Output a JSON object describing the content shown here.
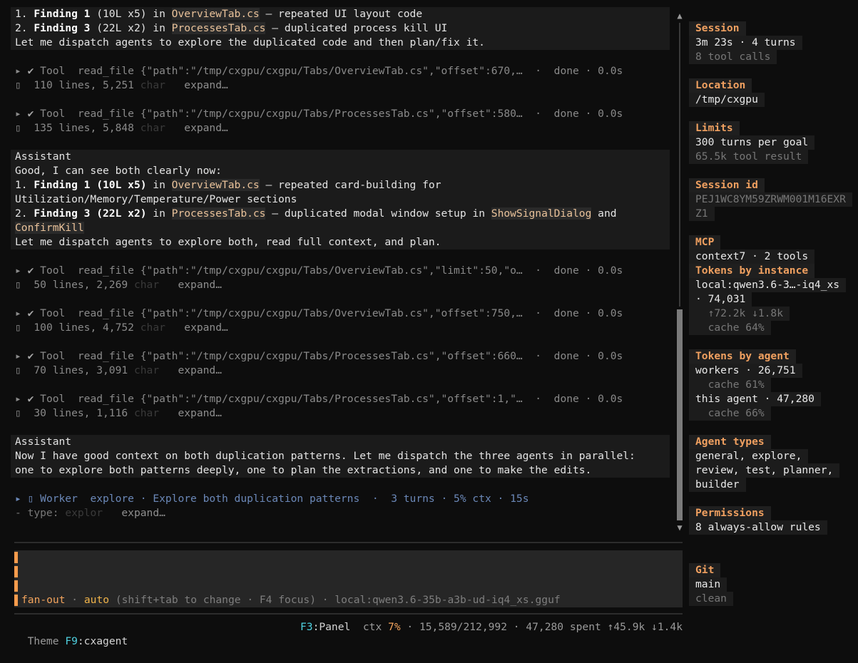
{
  "conversation": {
    "block1": {
      "line1": {
        "prefix": "1. ",
        "bold": "Finding 1",
        "mid": " (10L x5) in ",
        "code": "OverviewTab.cs",
        "suffix": " — repeated UI layout code"
      },
      "line2": {
        "prefix": "2. ",
        "bold": "Finding 3",
        "mid": " (22L x2) in ",
        "code": "ProcessesTab.cs",
        "suffix": " — duplicated process kill UI"
      },
      "line3": "Let me dispatch agents to explore the duplicated code and then plan/fix it."
    },
    "tools1": [
      {
        "label": "Tool",
        "call": "read_file {\"path\":\"/tmp/cxgpu/cxgpu/Tabs/OverviewTab.cs\",\"offset\":670,…",
        "status": "·  done · 0.0s",
        "result": "110 lines, 5,251",
        "fade": "char",
        "expand": "expand…"
      },
      {
        "label": "Tool",
        "call": "read_file {\"path\":\"/tmp/cxgpu/cxgpu/Tabs/ProcessesTab.cs\",\"offset\":580…",
        "status": "·  done · 0.0s",
        "result": "135 lines, 5,848",
        "fade": "char",
        "expand": "expand…"
      }
    ],
    "block2": {
      "role": "Assistant",
      "line1": "Good, I can see both clearly now:",
      "line2": {
        "prefix": "1. ",
        "bold": "Finding 1 (10L x5)",
        "mid": " in ",
        "code": "OverviewTab.cs",
        "suffix": " — repeated card-building for"
      },
      "line3": "Utilization/Memory/Temperature/Power sections",
      "line4": {
        "prefix": "2. ",
        "bold": "Finding 3 (22L x2)",
        "mid": " in ",
        "code": "ProcessesTab.cs",
        "suffix": " — duplicated modal window setup in ",
        "code2": "ShowSignalDialog",
        "suffix2": " and"
      },
      "line5": {
        "code": "ConfirmKill"
      },
      "line6": "Let me dispatch agents to explore both, read full context, and plan."
    },
    "tools2": [
      {
        "label": "Tool",
        "call": "read_file {\"path\":\"/tmp/cxgpu/cxgpu/Tabs/OverviewTab.cs\",\"limit\":50,\"o…",
        "status": "·  done · 0.0s",
        "result": "50 lines, 2,269",
        "fade": "char",
        "expand": "expand…"
      },
      {
        "label": "Tool",
        "call": "read_file {\"path\":\"/tmp/cxgpu/cxgpu/Tabs/OverviewTab.cs\",\"offset\":750,…",
        "status": "·  done · 0.0s",
        "result": "100 lines, 4,752",
        "fade": "char",
        "expand": "expand…"
      },
      {
        "label": "Tool",
        "call": "read_file {\"path\":\"/tmp/cxgpu/cxgpu/Tabs/ProcessesTab.cs\",\"offset\":660…",
        "status": "·  done · 0.0s",
        "result": "70 lines, 3,091",
        "fade": "char",
        "expand": "expand…"
      },
      {
        "label": "Tool",
        "call": "read_file {\"path\":\"/tmp/cxgpu/cxgpu/Tabs/ProcessesTab.cs\",\"offset\":1,\"…",
        "status": "·  done · 0.0s",
        "result": "30 lines, 1,116",
        "fade": "char",
        "expand": "expand…"
      }
    ],
    "block3": {
      "role": "Assistant",
      "line1": "Now I have good context on both duplication patterns. Let me dispatch the three agents in parallel:",
      "line2": "one to explore both patterns deeply, one to plan the extractions, and one to make the edits."
    },
    "worker": {
      "label": "Worker",
      "text": "explore · Explore both duplication patterns  ·  3 turns · 5% ctx · 15s",
      "sub_prefix": "- type:",
      "sub_fade": "explor",
      "sub_expand": "expand…"
    }
  },
  "input": {
    "mode_name": "fan-out",
    "mode_sep": " · ",
    "mode_value": "auto",
    "mode_hint": " (shift+tab to change · F4 focus) · local:qwen3.6-35b-a3b-ud-iq4_xs.gguf"
  },
  "status_bar": {
    "theme_label": "Theme",
    "theme_key": "F9",
    "theme_value": ":cxagent",
    "panel_key": "F3",
    "panel_label": ":Panel",
    "ctx_label": "ctx",
    "ctx_pct": "7%",
    "ctx_rest": " · 15,589/212,992 · 47,280 spent ↑45.9k ↓1.4k"
  },
  "panel": {
    "session": {
      "title": "Session",
      "line1": "3m 23s · 4 turns",
      "line2": "8 tool calls"
    },
    "location": {
      "title": "Location",
      "line1": "/tmp/cxgpu"
    },
    "limits": {
      "title": "Limits",
      "line1": "300 turns per goal",
      "line2": "65.5k tool result"
    },
    "session_id": {
      "title": "Session id",
      "line1": "PEJ1WC8YM59ZRWM001M16EXR",
      "line2": "Z1"
    },
    "mcp": {
      "title": "MCP",
      "line1": "context7 · 2 tools"
    },
    "tokens_instance": {
      "title": "Tokens by instance",
      "line1": "local:qwen3.6-3…-iq4_xs",
      "line2": "· 74,031",
      "line3": "  ↑72.2k ↓1.8k",
      "line4": "  cache 64%"
    },
    "tokens_agent": {
      "title": "Tokens by agent",
      "line1": "workers · 26,751",
      "line2": "  cache 61%",
      "line3": "this agent · 47,280",
      "line4": "  cache 66%"
    },
    "agent_types": {
      "title": "Agent types",
      "line1": "general, explore,",
      "line2": "review, test, planner,",
      "line3": "builder"
    },
    "permissions": {
      "title": "Permissions",
      "line1": "8 always-allow rules"
    },
    "git": {
      "title": "Git",
      "line1": "main",
      "line2": "clean"
    }
  }
}
